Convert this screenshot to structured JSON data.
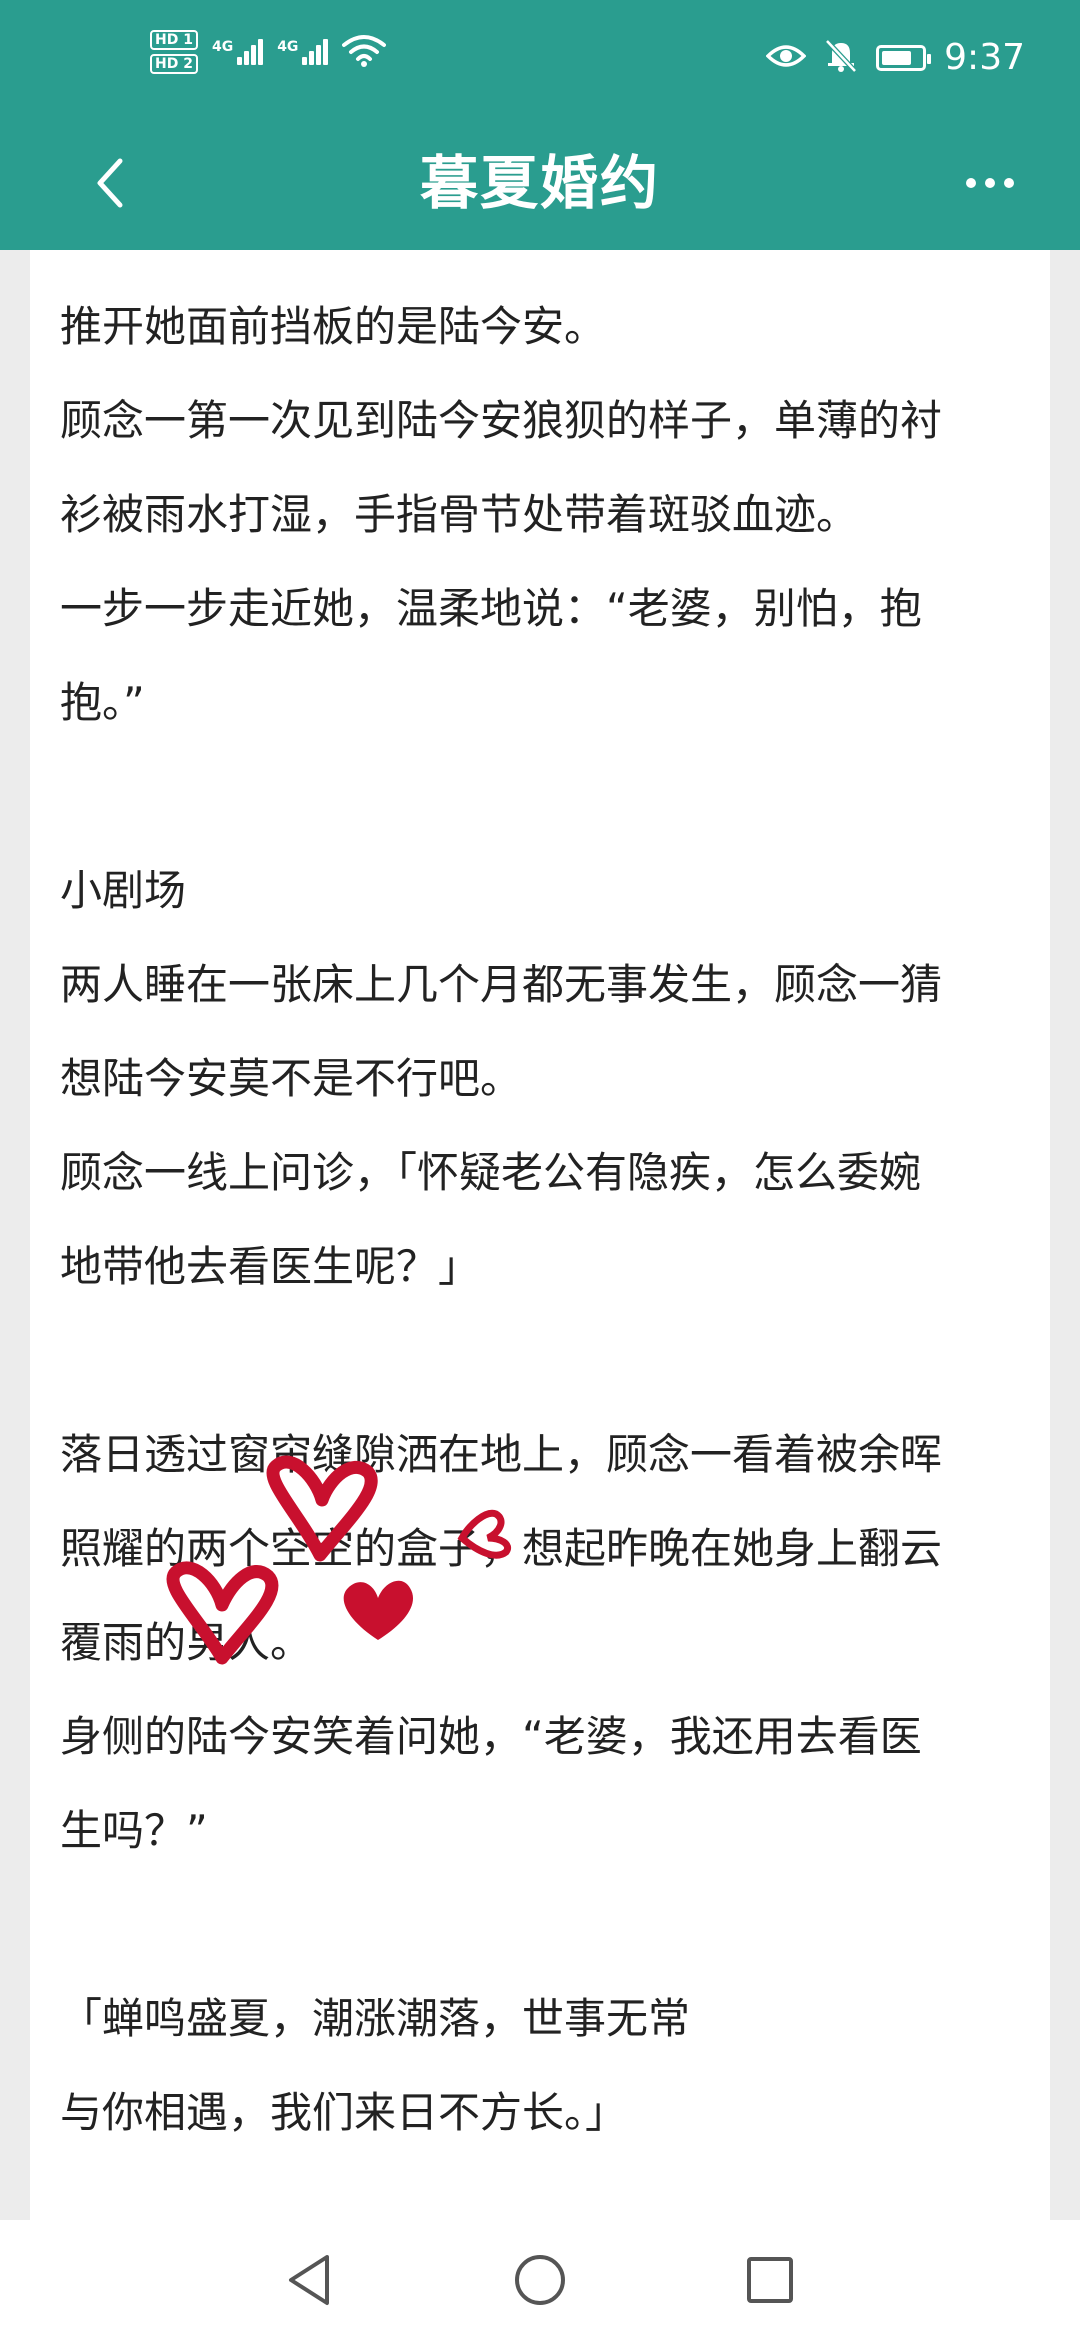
{
  "status_bar": {
    "sim1_label": "HD 1",
    "sim2_label": "HD 2",
    "network1": "4G",
    "network2": "4G",
    "time": "9:37",
    "battery_level": 0.75,
    "icons": [
      "eye-comfort-icon",
      "mute-icon",
      "battery-icon",
      "wifi-icon",
      "signal-icon"
    ]
  },
  "header": {
    "title": "暮夏婚约",
    "background_color": "#2a9d8f"
  },
  "content": {
    "lines": [
      "推开她面前挡板的是陆今安。",
      "顾念一第一次见到陆今安狼狈的样子，单薄的衬",
      "衫被雨水打湿，手指骨节处带着斑驳血迹。",
      "一步一步走近她，温柔地说：“老婆，别怕，抱",
      "抱。”",
      "",
      "小剧场",
      "两人睡在一张床上几个月都无事发生，顾念一猜",
      "想陆今安莫不是不行吧。",
      "顾念一线上问诊，「怀疑老公有隐疾，怎么委婉",
      "地带他去看医生呢？」",
      "",
      "落日透过窗帘缝隙洒在地上，顾念一看着被余晖",
      "照耀的两个空空的盒子，想起昨晚在她身上翻云",
      "覆雨的男人。",
      "身侧的陆今安笑着问她，“老婆，我还用去看医",
      "生吗？”",
      "",
      " 「蝉鸣盛夏，潮涨潮落，世事无常",
      "与你相遇，我们来日不方长。」"
    ]
  },
  "decorations": {
    "heart_color": "#c8102e"
  },
  "nav_bar": {
    "buttons": [
      "back-triangle-icon",
      "home-circle-icon",
      "recents-square-icon"
    ]
  }
}
